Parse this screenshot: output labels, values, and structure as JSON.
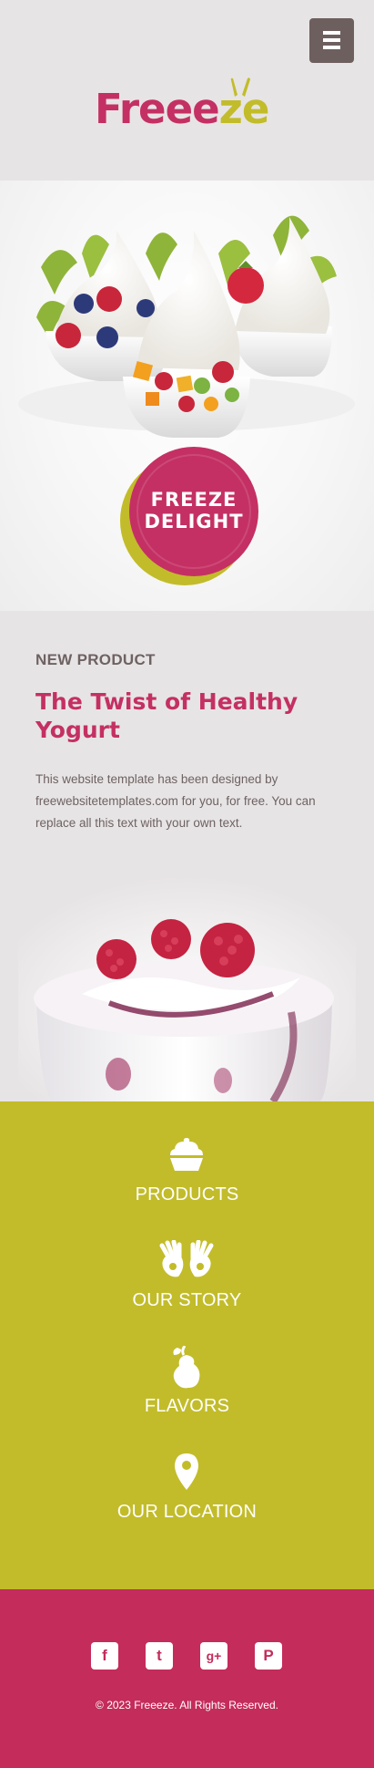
{
  "header": {
    "logo_main": "Freee",
    "logo_accent": "ze",
    "menu_icon": "hamburger-menu-icon"
  },
  "hero": {
    "badge_line1": "FREEZE",
    "badge_line2": "DELIGHT"
  },
  "product": {
    "eyebrow": "NEW PRODUCT",
    "headline": "The Twist of Healthy Yogurt",
    "description": "This website template has been designed by freewebsitetemplates.com for you, for free. You can replace all this text with your own text."
  },
  "nav": {
    "items": [
      {
        "label": "PRODUCTS",
        "icon": "cupcake-icon"
      },
      {
        "label": "OUR STORY",
        "icon": "hands-icon"
      },
      {
        "label": "FLAVORS",
        "icon": "pear-icon"
      },
      {
        "label": "OUR LOCATION",
        "icon": "map-pin-icon"
      }
    ]
  },
  "footer": {
    "social": [
      {
        "glyph": "f",
        "icon": "facebook-icon"
      },
      {
        "glyph": "t",
        "icon": "twitter-icon"
      },
      {
        "glyph": "g+",
        "icon": "google-plus-icon"
      },
      {
        "glyph": "P",
        "icon": "pinterest-icon"
      }
    ],
    "copyright": "© 2023 Freeeze. All Rights Reserved."
  },
  "colors": {
    "brand_pink": "#c43063",
    "brand_lime": "#c2bc2a",
    "footer_pink": "#c42c5b",
    "header_bg": "#e7e4e5",
    "menu_button": "#6e5f5f",
    "body_text": "#6e6262"
  }
}
